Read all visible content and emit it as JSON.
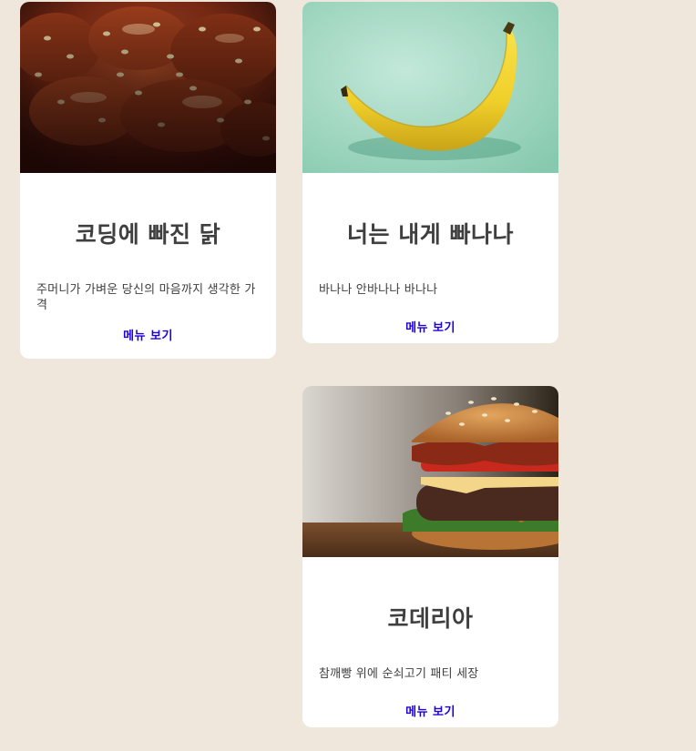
{
  "menus": [
    {
      "image_alt": "chicken-photo",
      "title": "코딩에 빠진 닭",
      "description": "주머니가 가벼운 당신의 마음까지 생각한 가격",
      "link_label": "메뉴 보기"
    },
    {
      "image_alt": "banana-photo",
      "title": "너는 내게 빠나나",
      "description": "바나나 안바나나 바나나",
      "link_label": "메뉴 보기"
    },
    {
      "image_alt": "burger-photo",
      "title": "코데리아",
      "description": "참깨빵 위에 순쇠고기 패티 세장",
      "link_label": "메뉴 보기"
    }
  ],
  "colors": {
    "background": "#efe6dc",
    "card": "#ffffff",
    "title": "#3f3f3f",
    "link": "#1f00d5"
  }
}
